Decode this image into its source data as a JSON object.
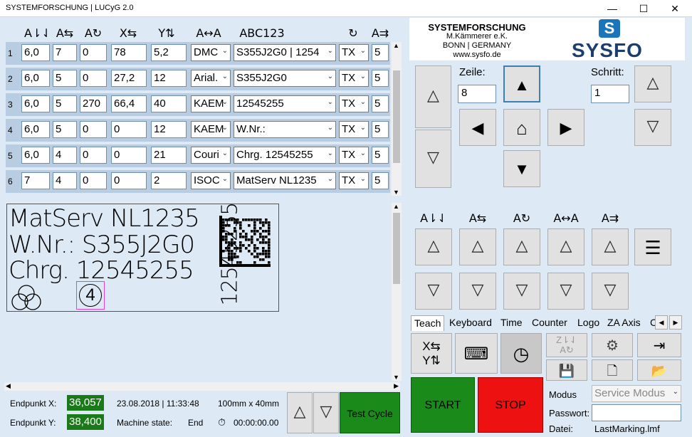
{
  "window": {
    "title": "SYSTEMFORSCHUNG | LUCyG 2.0",
    "min": "—",
    "max": "☐",
    "close": "✕"
  },
  "table": {
    "headers": [
      "A⇂⇃",
      "A⇆",
      "A↻",
      "X⇆",
      "Y⇅",
      "A↔A",
      "ABC123",
      "↻",
      "A⇉"
    ],
    "rows": [
      {
        "num": "1",
        "size": "6,0",
        "width": "7",
        "rotation": "0",
        "x": "78",
        "y": "5,2",
        "font": "DMC",
        "text": "S355J2G0 | 1254",
        "type": "TX",
        "last": "5"
      },
      {
        "num": "2",
        "size": "6,0",
        "width": "5",
        "rotation": "0",
        "x": "27,2",
        "y": "12",
        "font": "Arial.",
        "text": "S355J2G0",
        "type": "TX",
        "last": "5"
      },
      {
        "num": "3",
        "size": "6,0",
        "width": "5",
        "rotation": "270",
        "x": "66,4",
        "y": "40",
        "font": "KAEM",
        "text": "12545255",
        "type": "TX",
        "last": "5"
      },
      {
        "num": "4",
        "size": "6,0",
        "width": "5",
        "rotation": "0",
        "x": "0",
        "y": "12",
        "font": "KAEM",
        "text": "W.Nr.:",
        "type": "TX",
        "last": "5"
      },
      {
        "num": "5",
        "size": "6,0",
        "width": "4",
        "rotation": "0",
        "x": "0",
        "y": "21",
        "font": "Couri",
        "text": "Chrg. 12545255",
        "type": "TX",
        "last": "5"
      },
      {
        "num": "6",
        "size": "7",
        "width": "4",
        "rotation": "0",
        "x": "0",
        "y": "2",
        "font": "ISOC",
        "text": "MatServ NL1235",
        "type": "TX",
        "last": "5"
      }
    ]
  },
  "preview": {
    "line1": "MatServ NL1235",
    "line2": "W.Nr.: S355J2G0",
    "line3": "Chrg. 12545255",
    "vertical": "12545255",
    "circled": "4"
  },
  "status": {
    "endx_label": "Endpunkt  X:",
    "endx_value": "36,057",
    "endy_label": "Endpunkt  Y:",
    "endy_value": "38,400",
    "datetime": "23.08.2018 | 11:33:48",
    "size": "100mm x  40mm",
    "machine_state_label": "Machine state:",
    "machine_state_value": "End",
    "timer": "00:00:00.00",
    "test_cycle": "Test Cycle"
  },
  "company": {
    "name": "SYSTEMFORSCHUNG",
    "owner": "M.Kämmerer e.K.",
    "location": "BONN | GERMANY",
    "web": "www.sysfo.de",
    "logo_text": "SYSFO"
  },
  "teach": {
    "zeile_label": "Zeile:",
    "zeile_value": "8",
    "schritt_label": "Schritt:",
    "schritt_value": "1",
    "param_icons": [
      "A⇂⇃",
      "A⇆",
      "A↻",
      "A↔A",
      "A⇉"
    ]
  },
  "tabs": [
    "Teach",
    "Keyboard",
    "Time",
    "Counter",
    "Logo",
    "ZA Axis",
    "C"
  ],
  "bottom": {
    "start": "START",
    "stop": "STOP",
    "modus_label": "Modus",
    "modus_value": "Service Modus",
    "passwort_label": "Passwort:",
    "passwort_value": "",
    "datei_label": "Datei:",
    "datei_value": "LastMarking.lmf"
  },
  "colors": {
    "green": "#1a8a1a",
    "red": "#ee1111",
    "accent": "#1b75bb",
    "navy": "#1c3e6e"
  }
}
